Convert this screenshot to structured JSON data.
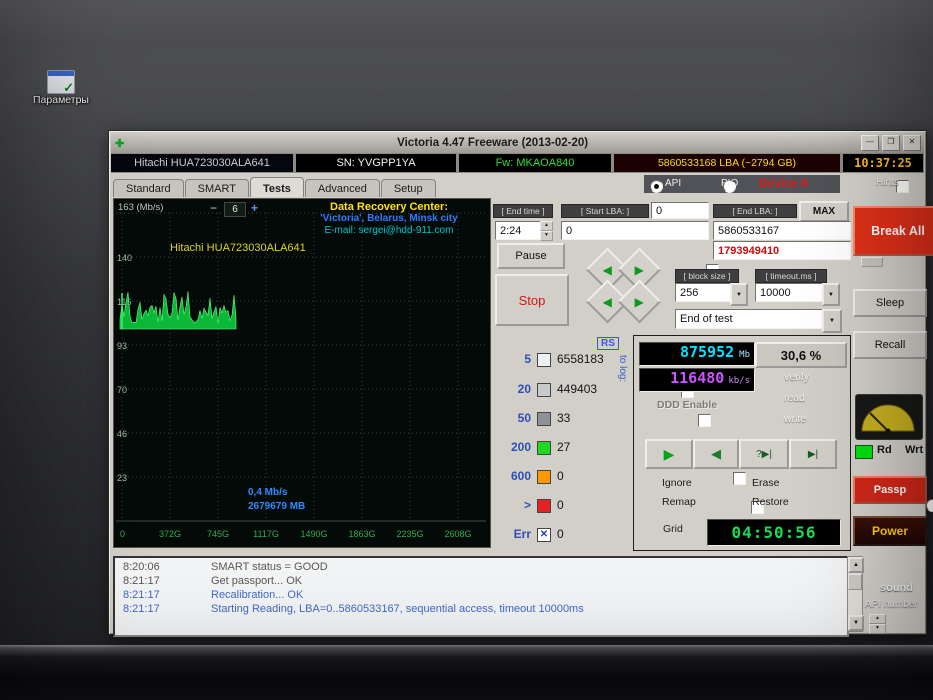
{
  "desktop": {
    "icon_label": "Параметры"
  },
  "window": {
    "title": "Victoria 4.47 Freeware (2013-02-20)",
    "icon_glyph": "✚",
    "min": "—",
    "max": "❐",
    "close": "✕"
  },
  "infobar": {
    "model": "Hitachi HUA723030ALA641",
    "serial": "SN: YVGPP1YA",
    "firmware": "Fw: MKAOA840",
    "lba": "5860533168 LBA (~2794 GB)",
    "clock": "10:37:25"
  },
  "modebar": {
    "api": "API",
    "pio": "PIO",
    "device": "Device 0",
    "hints": "Hints"
  },
  "tabs": [
    {
      "label": "Standard"
    },
    {
      "label": "SMART"
    },
    {
      "label": "Tests"
    },
    {
      "label": "Advanced"
    },
    {
      "label": "Setup"
    }
  ],
  "graph": {
    "y_top_label": "163 (Mb/s)",
    "scale_minus": "−",
    "scale_value": "6",
    "scale_plus": "+",
    "banner1": "Data Recovery Center:",
    "banner2": "'Victoria', Belarus, Minsk city",
    "banner3": "E-mail: sergei@hdd-911.com",
    "drive_label": "Hitachi HUA723030ALA641",
    "y_ticks": [
      "140",
      "116",
      "93",
      "70",
      "46",
      "23"
    ],
    "x_ticks": [
      "0",
      "372G",
      "745G",
      "1117G",
      "1490G",
      "1863G",
      "2235G",
      "2608G"
    ],
    "cursor_speed": "0,4 Mb/s",
    "cursor_pos": "2679679 MB",
    "band": {
      "seed": 9,
      "x0": 6,
      "x1": 122,
      "y_base": 130
    }
  },
  "controls": {
    "end_time_label": "[ End time ]",
    "end_time": "2:24",
    "start_lba_label": "[ Start LBA: ]",
    "start_lba_top": "0",
    "end_lba_label": "[ End LBA: ]",
    "max_label": "MAX",
    "start_value": "0",
    "end_value": "5860533167",
    "current_value": "1793949410",
    "pause": "Pause",
    "stop": "Stop",
    "block_label": "[ block size ]",
    "block_value": "256",
    "timeout_label": "[ timeout.ms ]",
    "timeout_value": "10000",
    "end_action": "End of test",
    "jog": [
      "◀",
      "▶",
      "◀",
      "▶"
    ]
  },
  "bins": {
    "rs": "RS",
    "to_log": "to log:",
    "err_glyph": "✕",
    "rows": [
      {
        "label": "5",
        "count": "6558183",
        "color": "#edf0f2"
      },
      {
        "label": "20",
        "count": "449403",
        "color": "#c6cacd"
      },
      {
        "label": "50",
        "count": "33",
        "color": "#8e9296"
      },
      {
        "label": "200",
        "count": "27",
        "color": "#22d822"
      },
      {
        "label": "600",
        "count": "0",
        "color": "#ff9900"
      },
      {
        "label": ">",
        "count": "0",
        "color": "#e42222"
      },
      {
        "label": "Err",
        "count": "0",
        "color": "#ffffff"
      }
    ]
  },
  "progress": {
    "read_value": "875952",
    "read_unit": "Mb",
    "percent": "30,6 %",
    "speed_value": "116480",
    "speed_unit": "kb/s",
    "ddd": "DDD Enable",
    "verify": "verify",
    "read": "read",
    "write": "write",
    "seek": [
      "▶",
      "◀",
      "?▶|",
      "▶|"
    ],
    "ignore": "Ignore",
    "erase": "Erase",
    "remap": "Remap",
    "restore": "Restore",
    "grid": "Grid",
    "timer": "04:50:56"
  },
  "sidebar": {
    "break_all": "Break All",
    "sleep": "Sleep",
    "recall": "Recall",
    "rd": "Rd",
    "wrt": "Wrt",
    "passp": "Passp",
    "power": "Power",
    "sound": "sound",
    "api_number": "API number"
  },
  "log": {
    "lines": [
      {
        "time": "8:20:06",
        "text": "SMART status = GOOD",
        "color": "#5a5a50"
      },
      {
        "time": "8:21:17",
        "text": "Get passport... OK",
        "color": "#5a5a50"
      },
      {
        "time": "8:21:17",
        "text": "Recalibration... OK",
        "color": "#4169cc"
      },
      {
        "time": "8:21:17",
        "text": "Starting Reading, LBA=0..5860533167, sequential access, timeout 10000ms",
        "color": "#4169cc"
      }
    ]
  },
  "icons": {
    "up": "▲",
    "down": "▼",
    "check": "✓"
  }
}
